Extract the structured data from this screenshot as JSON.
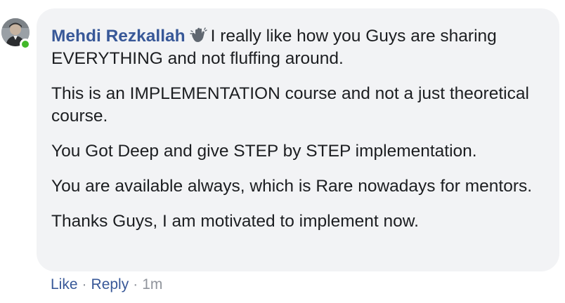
{
  "comment": {
    "author": "Mehdi Rezkallah",
    "paragraphs": [
      "I really like how you Guys are sharing EVERYTHING and not fluffing around.",
      "This is an IMPLEMENTATION course and not a just theoretical course.",
      "You Got Deep and give STEP by STEP implementation.",
      "You are available always, which is Rare nowadays for mentors.",
      "Thanks Guys, I am motivated to implement now."
    ],
    "icons": {
      "badge": "waving-hand-icon",
      "status": "online-status-indicator"
    }
  },
  "actions": {
    "like_label": "Like",
    "reply_label": "Reply",
    "separator": "·",
    "timestamp": "1m"
  },
  "colors": {
    "author_link": "#385898",
    "bubble_bg": "#f2f3f5",
    "online_green": "#42b72a",
    "meta_gray": "#90949c"
  }
}
